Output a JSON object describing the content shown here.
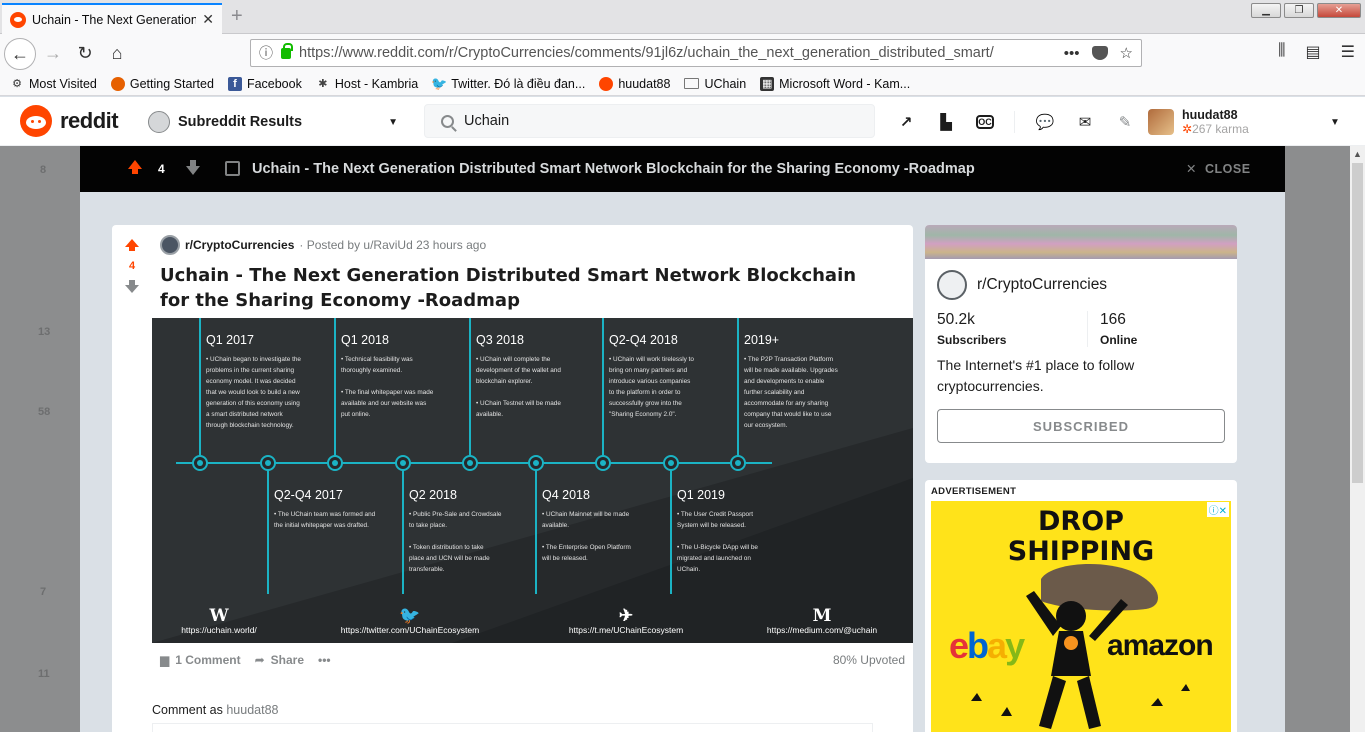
{
  "browser": {
    "tab_title": "Uchain - The Next Generation D",
    "new_tab": "+",
    "url": "https://www.reddit.com/r/CryptoCurrencies/comments/91jl6z/uchain_the_next_generation_distributed_smart/",
    "url_menu": "•••",
    "bookmarks": [
      {
        "label": "Most Visited",
        "icon": "gear-icon"
      },
      {
        "label": "Getting Started",
        "icon": "firefox-icon"
      },
      {
        "label": "Facebook",
        "icon": "facebook-icon"
      },
      {
        "label": "Host - Kambria",
        "icon": "kambria-icon"
      },
      {
        "label": "Twitter. Đó là điều đan...",
        "icon": "twitter-icon"
      },
      {
        "label": "huudat88",
        "icon": "reddit-icon"
      },
      {
        "label": "UChain",
        "icon": "folder-icon"
      },
      {
        "label": "Microsoft Word - Kam...",
        "icon": "doc-icon"
      }
    ]
  },
  "reddit_header": {
    "logo_text": "reddit",
    "subreddit_dropdown": "Subreddit Results",
    "search_value": "Uchain",
    "username": "huudat88",
    "karma": "267 karma"
  },
  "modal": {
    "score": "4",
    "title": "Uchain - The Next Generation Distributed Smart Network Blockchain for the Sharing Economy -Roadmap",
    "close_label": "CLOSE"
  },
  "post": {
    "subreddit": "r/CryptoCurrencies",
    "posted_by": "· Posted by u/RaviUd 23 hours ago",
    "score": "4",
    "title": "Uchain - The Next Generation Distributed Smart Network Blockchain for the Sharing Economy -Roadmap",
    "comments": "1 Comment",
    "share": "Share",
    "more": "•••",
    "upvoted": "80% Upvoted",
    "comment_as_label": "Comment as",
    "comment_as_user": "huudat88"
  },
  "roadmap": {
    "top": [
      {
        "title": "Q1 2017",
        "lines": [
          "• UChain began to investigate the",
          "problems in the current sharing",
          "economy model. It was decided",
          "that we would look to build a new",
          "generation of this economy using",
          "a smart distributed network",
          "through blockchain technology."
        ]
      },
      {
        "title": "Q1 2018",
        "lines": [
          "• Technical feasibility was",
          "thoroughly examined.",
          "",
          "• The final whitepaper was made",
          "available and our website was",
          "put online."
        ]
      },
      {
        "title": "Q3 2018",
        "lines": [
          "• UChain will complete the",
          "development of the wallet and",
          "blockchain explorer.",
          "",
          "• UChain Testnet will be made",
          "available."
        ]
      },
      {
        "title": "Q2-Q4 2018",
        "lines": [
          "• UChain will work tirelessly to",
          "bring on many partners and",
          "introduce various companies",
          "to the platform in order to",
          "successfully grow into the",
          "\"Sharing Economy 2.0\"."
        ]
      },
      {
        "title": "2019+",
        "lines": [
          "• The P2P Transaction Platform",
          "will be made available. Upgrades",
          "and developments to enable",
          "further scalability and",
          "accommodate for any sharing",
          "company that would like to use",
          "our ecosystem."
        ]
      }
    ],
    "bottom": [
      {
        "title": "Q2-Q4 2017",
        "lines": [
          "• The UChain team was formed and",
          "the initial whitepaper was drafted."
        ]
      },
      {
        "title": "Q2 2018",
        "lines": [
          "• Public Pre-Sale and Crowdsale",
          "to take place.",
          "",
          "• Token distribution to take",
          "place and UCN will be made",
          "transferable."
        ]
      },
      {
        "title": "Q4 2018",
        "lines": [
          "• UChain Mainnet will be made",
          "available.",
          "",
          "• The Enterprise Open Platform",
          "will be released."
        ]
      },
      {
        "title": "Q1 2019",
        "lines": [
          "• The User Credit Passport",
          "System will be released.",
          "",
          "• The U-Bicycle DApp will be",
          "migrated and launched on",
          "UChain."
        ]
      }
    ],
    "footer": [
      {
        "glyph": "W",
        "url": "https://uchain.world/"
      },
      {
        "glyph": "🐦",
        "url": "https://twitter.com/UChainEcosystem"
      },
      {
        "glyph": "✈",
        "url": "https://t.me/UChainEcosystem"
      },
      {
        "glyph": "M",
        "url": "https://medium.com/@uchain"
      }
    ]
  },
  "sidebar": {
    "subreddit": "r/CryptoCurrencies",
    "subscribers_num": "50.2k",
    "subscribers_label": "Subscribers",
    "online_num": "166",
    "online_label": "Online",
    "description": "The Internet's #1 place to follow cryptocurrencies.",
    "subscribed_button": "SUBSCRIBED"
  },
  "ad": {
    "label": "ADVERTISEMENT",
    "line1": "DROP",
    "line2": "SHIPPING",
    "brand1": "ebay",
    "brand2": "amazon"
  },
  "background": {
    "left_numbers": [
      "8",
      "13",
      "58",
      "7",
      "11"
    ]
  },
  "colors": {
    "reddit_orange": "#ff4500",
    "modal_bar": "#030303",
    "roadmap_bg": "#26292b",
    "roadmap_line": "#1bb3c4"
  }
}
